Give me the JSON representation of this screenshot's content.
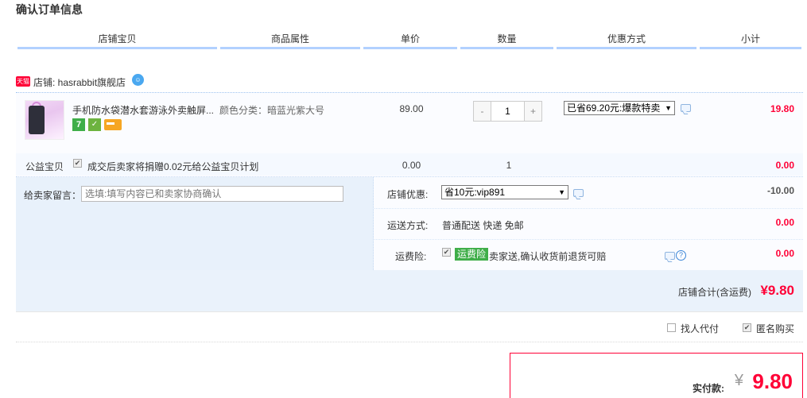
{
  "page_title": "确认订单信息",
  "columns": [
    "店铺宝贝",
    "商品属性",
    "单价",
    "数量",
    "优惠方式",
    "小计"
  ],
  "shop": {
    "badge": "天猫",
    "label": "店铺: hasrabbit旗舰店",
    "wangwang_icon": "chat-bubble-icon"
  },
  "item": {
    "title": "手机防水袋潜水套游泳外卖触屏...",
    "attr": "颜色分类：暗蓝光紫大号",
    "price": "89.00",
    "qty_minus": "-",
    "qty_value": "1",
    "qty_plus": "+",
    "promo": "已省69.20元:爆款特卖",
    "subtotal": "19.80",
    "badge_7": "7"
  },
  "charity": {
    "label": "公益宝贝",
    "checkbox": "✔",
    "text": "成交后卖家将捐赠0.02元给公益宝贝计划",
    "price": "0.00",
    "qty": "1",
    "subtotal": "0.00"
  },
  "memo": {
    "label": "给卖家留言：",
    "placeholder": "选填:填写内容已和卖家协商确认"
  },
  "shop_discount": {
    "label": "店铺优惠:",
    "value": "省10元:vip891",
    "amount": "-10.00"
  },
  "shipping": {
    "label": "运送方式:",
    "value": "普通配送 快递 免邮",
    "amount": "0.00"
  },
  "insurance": {
    "label": "运费险:",
    "checkbox": "✔",
    "tag": "运费险",
    "text": "卖家送,确认收货前退货可赔",
    "amount": "0.00",
    "help": "?"
  },
  "shop_total": {
    "label": "店铺合计(含运费)",
    "value": "¥9.80"
  },
  "options": {
    "find_pay": "找人代付",
    "anonymous": "匿名购买",
    "anonymous_checked": "✔"
  },
  "payment": {
    "label": "实付款:",
    "currency": "¥",
    "value": "9.80"
  },
  "colors": {
    "accent": "#ff0036",
    "header_underline": "#b2d1ff",
    "panel_blue": "#e8f1fb"
  }
}
